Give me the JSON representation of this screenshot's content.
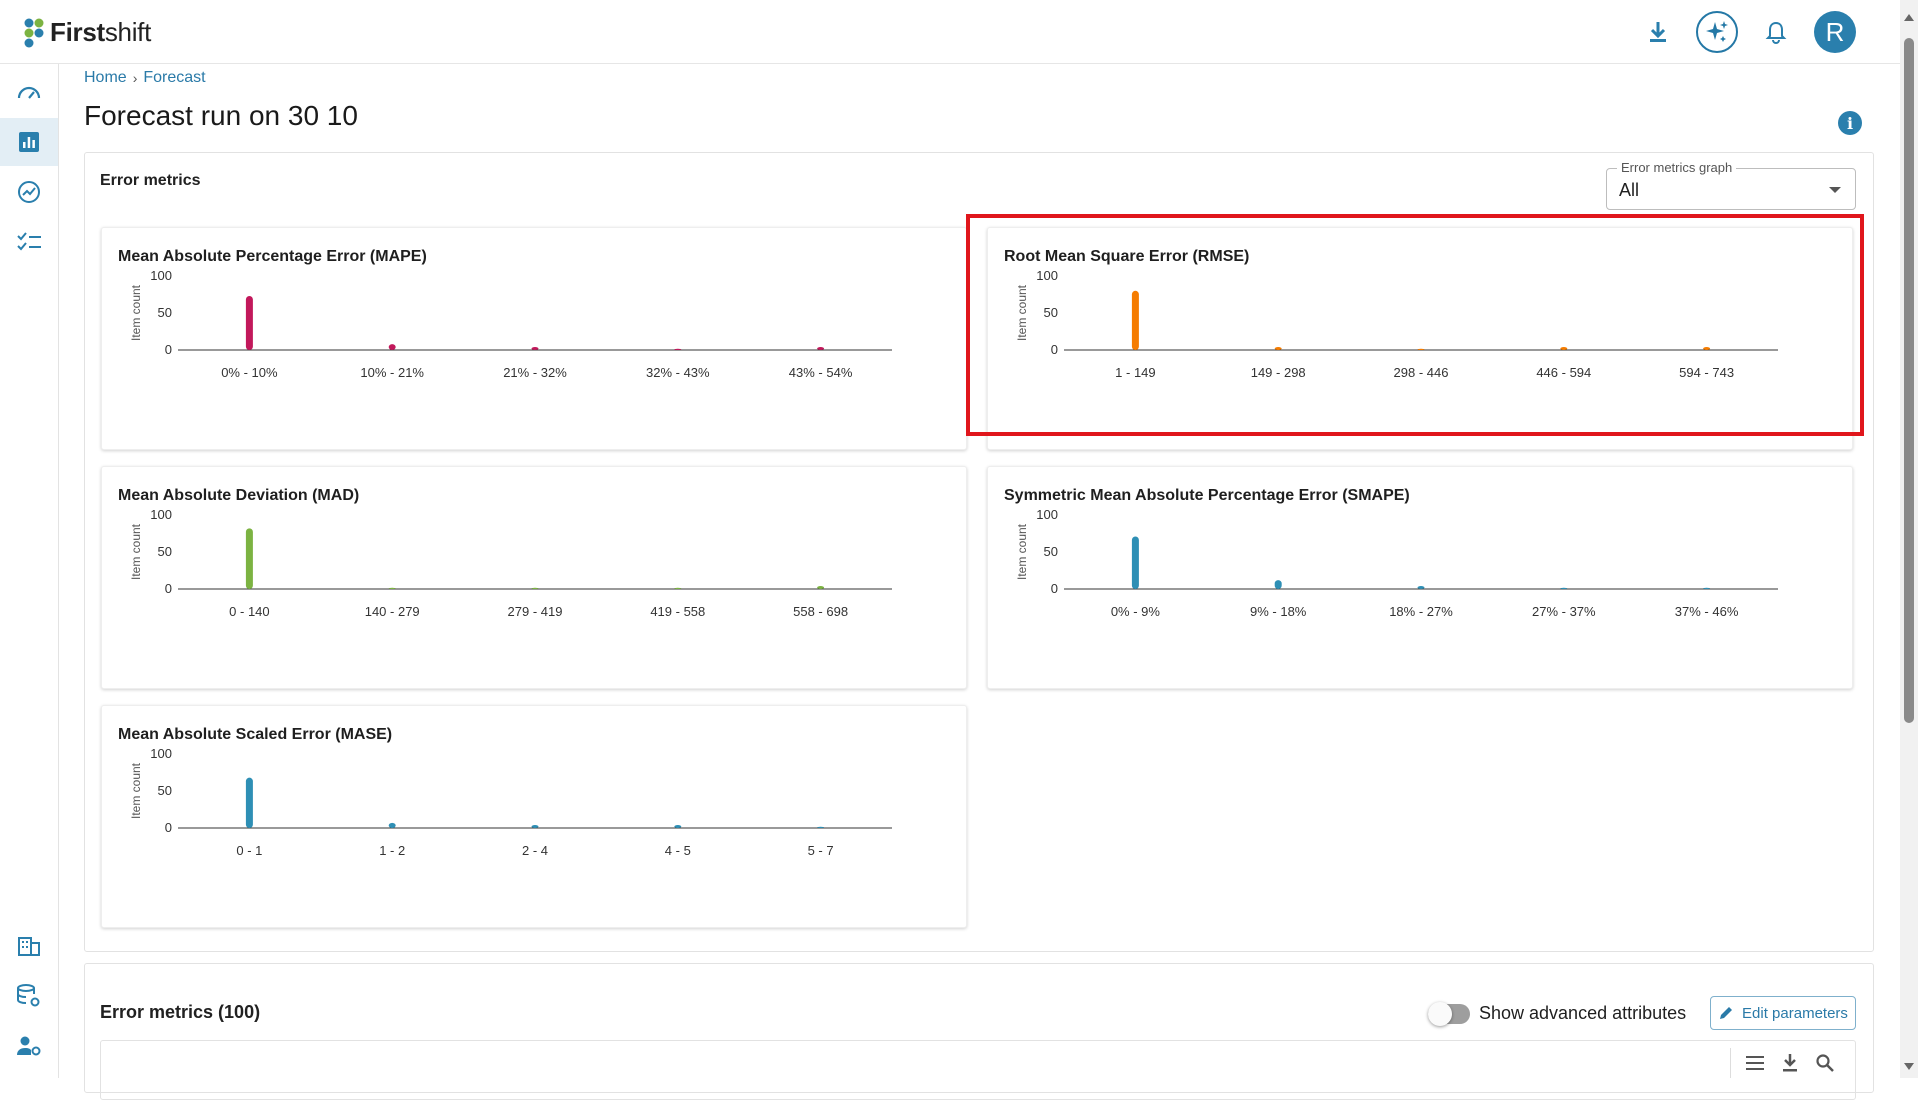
{
  "app": {
    "brand_bold": "First",
    "brand_light": "shift",
    "avatar_initial": "R"
  },
  "header_icons": [
    "download-icon",
    "ai-sparkle-icon",
    "bell-icon",
    "avatar"
  ],
  "sidebar": {
    "items": [
      {
        "icon": "dashboard-gauge-icon",
        "active": false
      },
      {
        "icon": "bar-chart-icon",
        "active": true
      },
      {
        "icon": "trend-icon",
        "active": false
      },
      {
        "icon": "checklist-icon",
        "active": false
      },
      {
        "icon": "building-icon",
        "active": false
      },
      {
        "icon": "database-settings-icon",
        "active": false
      },
      {
        "icon": "user-settings-icon",
        "active": false
      }
    ]
  },
  "breadcrumb": {
    "home": "Home",
    "separator": "›",
    "current": "Forecast"
  },
  "page": {
    "title": "Forecast run on 30 10"
  },
  "error_metrics_panel": {
    "title": "Error metrics",
    "graph_select": {
      "label": "Error metrics graph",
      "value": "All"
    }
  },
  "chart_data": [
    {
      "type": "bar",
      "title": "Mean Absolute Percentage Error (MAPE)",
      "ylabel": "Item count",
      "ylim": [
        0,
        100
      ],
      "yticks": [
        "100",
        "50",
        "0"
      ],
      "color": "#c2185b",
      "categories": [
        "0% - 10%",
        "10% - 21%",
        "21% - 32%",
        "32% - 43%",
        "43% - 54%"
      ],
      "values": [
        73,
        8,
        3,
        0,
        1
      ]
    },
    {
      "type": "bar",
      "title": "Root Mean Square Error (RMSE)",
      "ylabel": "Item count",
      "ylim": [
        0,
        100
      ],
      "yticks": [
        "100",
        "50",
        "0"
      ],
      "color": "#f57c00",
      "categories": [
        "1 - 149",
        "149 - 298",
        "298 - 446",
        "446 - 594",
        "594 - 743"
      ],
      "values": [
        80,
        3,
        0,
        1,
        1
      ]
    },
    {
      "type": "bar",
      "title": "Mean Absolute Deviation (MAD)",
      "ylabel": "Item count",
      "ylim": [
        0,
        100
      ],
      "yticks": [
        "100",
        "50",
        "0"
      ],
      "color": "#7cb342",
      "categories": [
        "0 - 140",
        "140 - 279",
        "279 - 419",
        "419 - 558",
        "558 - 698"
      ],
      "values": [
        82,
        0,
        0,
        0,
        1
      ]
    },
    {
      "type": "bar",
      "title": "Symmetric Mean Absolute Percentage Error (SMAPE)",
      "ylabel": "Item count",
      "ylim": [
        0,
        100
      ],
      "yticks": [
        "100",
        "50",
        "0"
      ],
      "color": "#2e8fb5",
      "categories": [
        "0% - 9%",
        "9% - 18%",
        "18% - 27%",
        "27% - 37%",
        "37% - 46%"
      ],
      "values": [
        71,
        12,
        2,
        0,
        0
      ]
    },
    {
      "type": "bar",
      "title": "Mean Absolute Scaled Error (MASE)",
      "ylabel": "Item count",
      "ylim": [
        0,
        100
      ],
      "yticks": [
        "100",
        "50",
        "0"
      ],
      "color": "#2e8fb5",
      "categories": [
        "0 - 1",
        "1 - 2",
        "2 - 4",
        "4 - 5",
        "5 - 7"
      ],
      "values": [
        68,
        7,
        4,
        3,
        0
      ]
    }
  ],
  "error_table_panel": {
    "title": "Error metrics (100)",
    "toggle_label": "Show advanced attributes",
    "toggle_on": false,
    "edit_button": "Edit parameters"
  },
  "colors": {
    "primary": "#2a7fad",
    "highlight_box": "#e0161c"
  }
}
